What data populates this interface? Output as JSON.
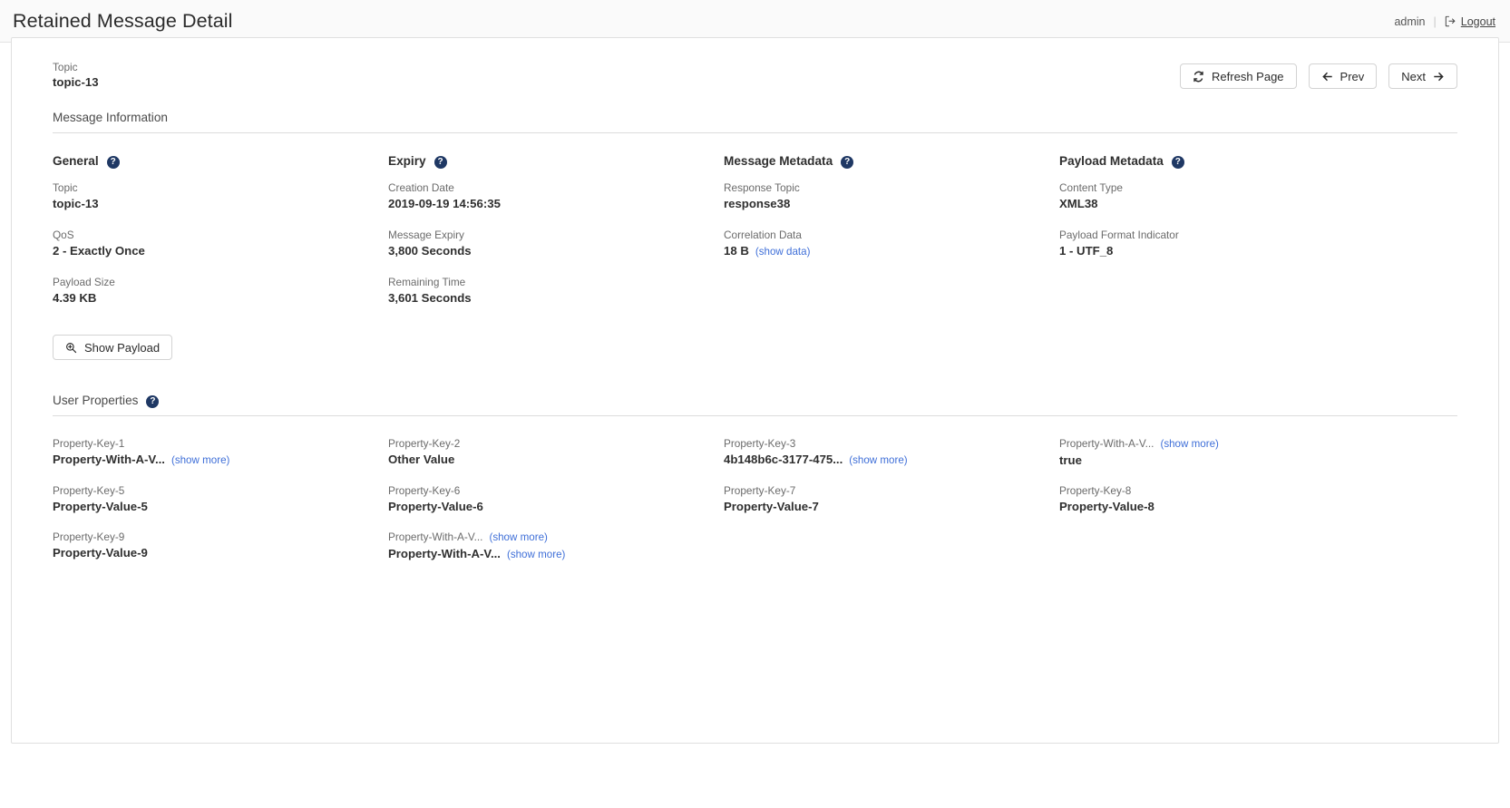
{
  "header": {
    "title": "Retained Message Detail",
    "user": "admin",
    "divider": "|",
    "logout_label": "Logout",
    "logout_icon": "logout-icon"
  },
  "topic_header": {
    "label": "Topic",
    "value": "topic-13"
  },
  "toolbar": {
    "refresh_label": "Refresh Page",
    "refresh_icon": "refresh-icon",
    "prev_label": "Prev",
    "prev_icon": "arrow-left-icon",
    "next_label": "Next",
    "next_icon": "arrow-right-icon"
  },
  "message_information": {
    "section_title": "Message Information",
    "help_icon": "question-mark-icon",
    "columns": [
      {
        "title": "General",
        "fields": [
          {
            "key": "Topic",
            "value": "topic-13"
          },
          {
            "key": "QoS",
            "value": "2 - Exactly Once"
          },
          {
            "key": "Payload Size",
            "value": "4.39 KB"
          }
        ]
      },
      {
        "title": "Expiry",
        "fields": [
          {
            "key": "Creation Date",
            "value": "2019-09-19 14:56:35"
          },
          {
            "key": "Message Expiry",
            "value": "3,800 Seconds"
          },
          {
            "key": "Remaining Time",
            "value": "3,601 Seconds"
          }
        ]
      },
      {
        "title": "Message Metadata",
        "fields": [
          {
            "key": "Response Topic",
            "value": "response38"
          },
          {
            "key": "Correlation Data",
            "value": "18 B",
            "link": "(show data)"
          }
        ]
      },
      {
        "title": "Payload Metadata",
        "fields": [
          {
            "key": "Content Type",
            "value": "XML38"
          },
          {
            "key": "Payload Format Indicator",
            "value": "1 - UTF_8"
          }
        ]
      }
    ]
  },
  "show_payload": {
    "label": "Show Payload",
    "icon": "zoom-in-icon"
  },
  "user_properties": {
    "section_title": "User Properties",
    "help_icon": "question-mark-icon",
    "items": [
      {
        "key": "Property-Key-1",
        "key_link": "",
        "value": "Property-With-A-V...",
        "value_link": "(show more)"
      },
      {
        "key": "Property-Key-2",
        "key_link": "",
        "value": "Other Value",
        "value_link": ""
      },
      {
        "key": "Property-Key-3",
        "key_link": "",
        "value": "4b148b6c-3177-475...",
        "value_link": "(show more)"
      },
      {
        "key": "Property-With-A-V...",
        "key_link": "(show more)",
        "value": "true",
        "value_link": ""
      },
      {
        "key": "Property-Key-5",
        "key_link": "",
        "value": "Property-Value-5",
        "value_link": ""
      },
      {
        "key": "Property-Key-6",
        "key_link": "",
        "value": "Property-Value-6",
        "value_link": ""
      },
      {
        "key": "Property-Key-7",
        "key_link": "",
        "value": "Property-Value-7",
        "value_link": ""
      },
      {
        "key": "Property-Key-8",
        "key_link": "",
        "value": "Property-Value-8",
        "value_link": ""
      },
      {
        "key": "Property-Key-9",
        "key_link": "",
        "value": "Property-Value-9",
        "value_link": ""
      },
      {
        "key": "Property-With-A-V...",
        "key_link": "(show more)",
        "value": "Property-With-A-V...",
        "value_link": "(show more)"
      }
    ]
  },
  "colors": {
    "accent": "#1f3864",
    "link": "#3f6fd8",
    "border": "#e0e0e0",
    "topbar_bg": "#fafafa"
  }
}
